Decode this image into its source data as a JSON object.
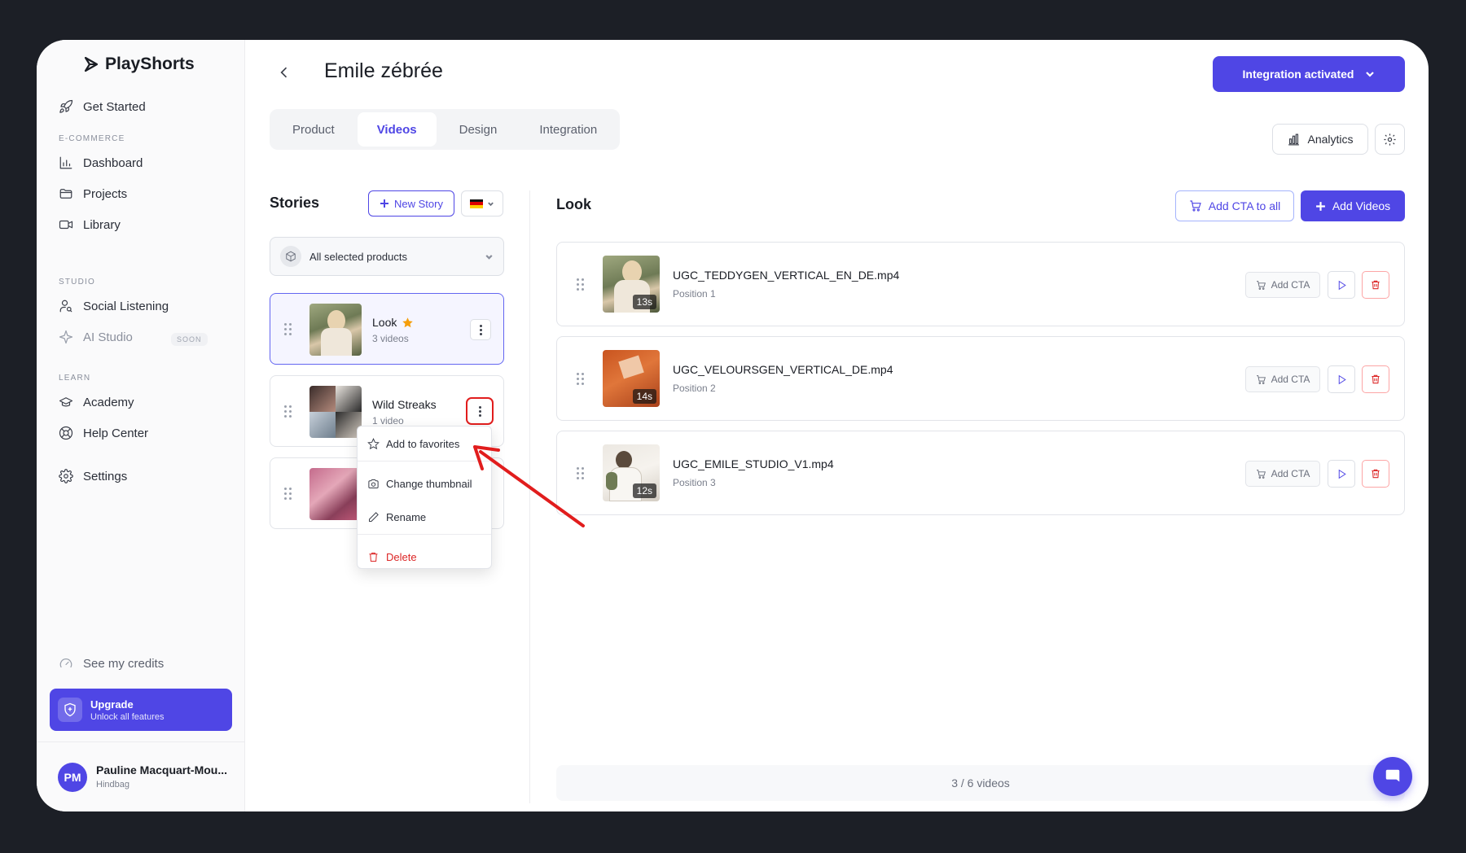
{
  "app": {
    "name": "PlayShorts"
  },
  "sidebar": {
    "get_started": "Get Started",
    "sections": {
      "ecommerce": "E-COMMERCE",
      "studio": "STUDIO",
      "learn": "LEARN"
    },
    "items": {
      "dashboard": "Dashboard",
      "projects": "Projects",
      "library": "Library",
      "social_listening": "Social Listening",
      "ai_studio": "AI Studio",
      "soon": "SOON",
      "academy": "Academy",
      "help_center": "Help Center",
      "settings": "Settings"
    },
    "credits": "See my credits",
    "upgrade": {
      "title": "Upgrade",
      "subtitle": "Unlock all features"
    },
    "user": {
      "initials": "PM",
      "name": "Pauline Macquart-Mou...",
      "org": "Hindbag"
    }
  },
  "header": {
    "title": "Emile zébrée",
    "integration_label": "Integration activated",
    "analytics_label": "Analytics",
    "tabs": [
      "Product",
      "Videos",
      "Design",
      "Integration"
    ],
    "active_tab": "Videos"
  },
  "stories": {
    "title": "Stories",
    "new_story": "New Story",
    "language": "de",
    "product_filter": "All selected products",
    "items": [
      {
        "name": "Look",
        "count": "3 videos",
        "favorite": true,
        "selected": true
      },
      {
        "name": "Wild Streaks",
        "count": "1 video",
        "favorite": false,
        "selected": false
      },
      {
        "name": "",
        "count": "",
        "favorite": false,
        "selected": false
      }
    ],
    "context_menu": {
      "add_favorites": "Add to favorites",
      "change_thumbnail": "Change thumbnail",
      "rename": "Rename",
      "delete": "Delete"
    }
  },
  "look": {
    "title": "Look",
    "add_cta_all": "Add CTA to all",
    "add_videos": "Add Videos",
    "add_cta": "Add CTA",
    "videos": [
      {
        "name": "UGC_TEDDYGEN_VERTICAL_EN_DE.mp4",
        "position": "Position 1",
        "duration": "13s"
      },
      {
        "name": "UGC_VELOURSGEN_VERTICAL_DE.mp4",
        "position": "Position 2",
        "duration": "14s"
      },
      {
        "name": "UGC_EMILE_STUDIO_V1.mp4",
        "position": "Position 3",
        "duration": "12s"
      }
    ],
    "footer": "3 / 6 videos"
  },
  "colors": {
    "accent": "#4f46e5",
    "danger": "#dc2626",
    "star": "#f59e0b",
    "annotation": "#e11d1d"
  }
}
